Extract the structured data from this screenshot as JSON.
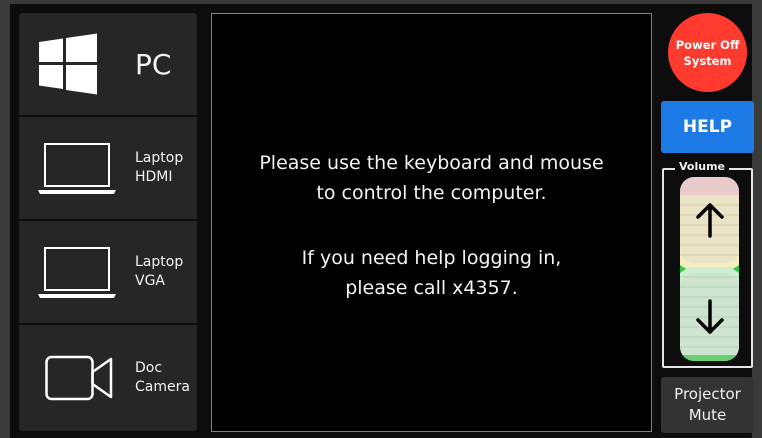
{
  "sources": [
    {
      "id": "pc",
      "label": "PC",
      "icon": "windows-logo-icon"
    },
    {
      "id": "laptop-hdmi",
      "label": "Laptop\nHDMI",
      "icon": "laptop-icon"
    },
    {
      "id": "laptop-vga",
      "label": "Laptop\nVGA",
      "icon": "laptop-icon"
    },
    {
      "id": "doc-camera",
      "label": "Doc\nCamera",
      "icon": "video-camera-icon"
    }
  ],
  "screen": {
    "line1": "Please use the keyboard and mouse",
    "line2": "to control the computer.",
    "line3": "If you need help logging in,",
    "line4": "please call x4357."
  },
  "controls": {
    "power_label": "Power Off\nSystem",
    "help_label": "HELP",
    "volume_label": "Volume",
    "mute_label": "Projector\nMute"
  },
  "colors": {
    "power": "#ff3b30",
    "help": "#1e7be6",
    "volume_high": "#f6c6c6",
    "volume_mid": "#f7eec0",
    "volume_low": "#cdeed0",
    "volume_marker": "#2ecc40"
  }
}
